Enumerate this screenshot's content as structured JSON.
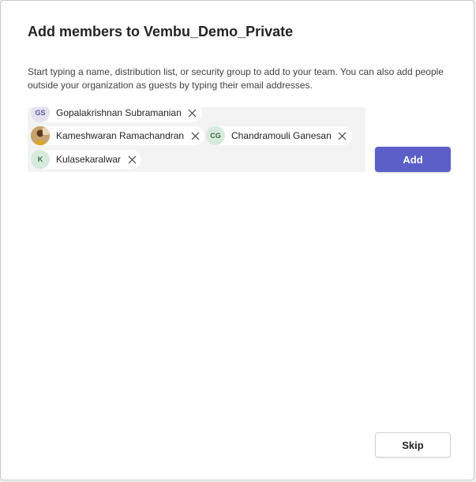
{
  "dialog": {
    "title": "Add members to Vembu_Demo_Private",
    "description": "Start typing a name, distribution list, or security group to add to your team. You can also add people outside your organization as guests by typing their email addresses."
  },
  "picker": {
    "chips": [
      {
        "initials": "GS",
        "name": "Gopalakrishnan Subramanian",
        "avatar": "initials"
      },
      {
        "initials": "",
        "name": "Kameshwaran Ramachandran",
        "avatar": "photo"
      },
      {
        "initials": "CG",
        "name": "Chandramouli Ganesan",
        "avatar": "initials"
      },
      {
        "initials": "K",
        "name": "Kulasekaralwar",
        "avatar": "initials"
      }
    ]
  },
  "buttons": {
    "add_label": "Add",
    "skip_label": "Skip"
  },
  "colors": {
    "accent": "#5b5fc7",
    "picker_background": "#f3f3f3"
  },
  "icons": {
    "remove": "close-icon",
    "photo_avatar": "user-photo-icon"
  }
}
